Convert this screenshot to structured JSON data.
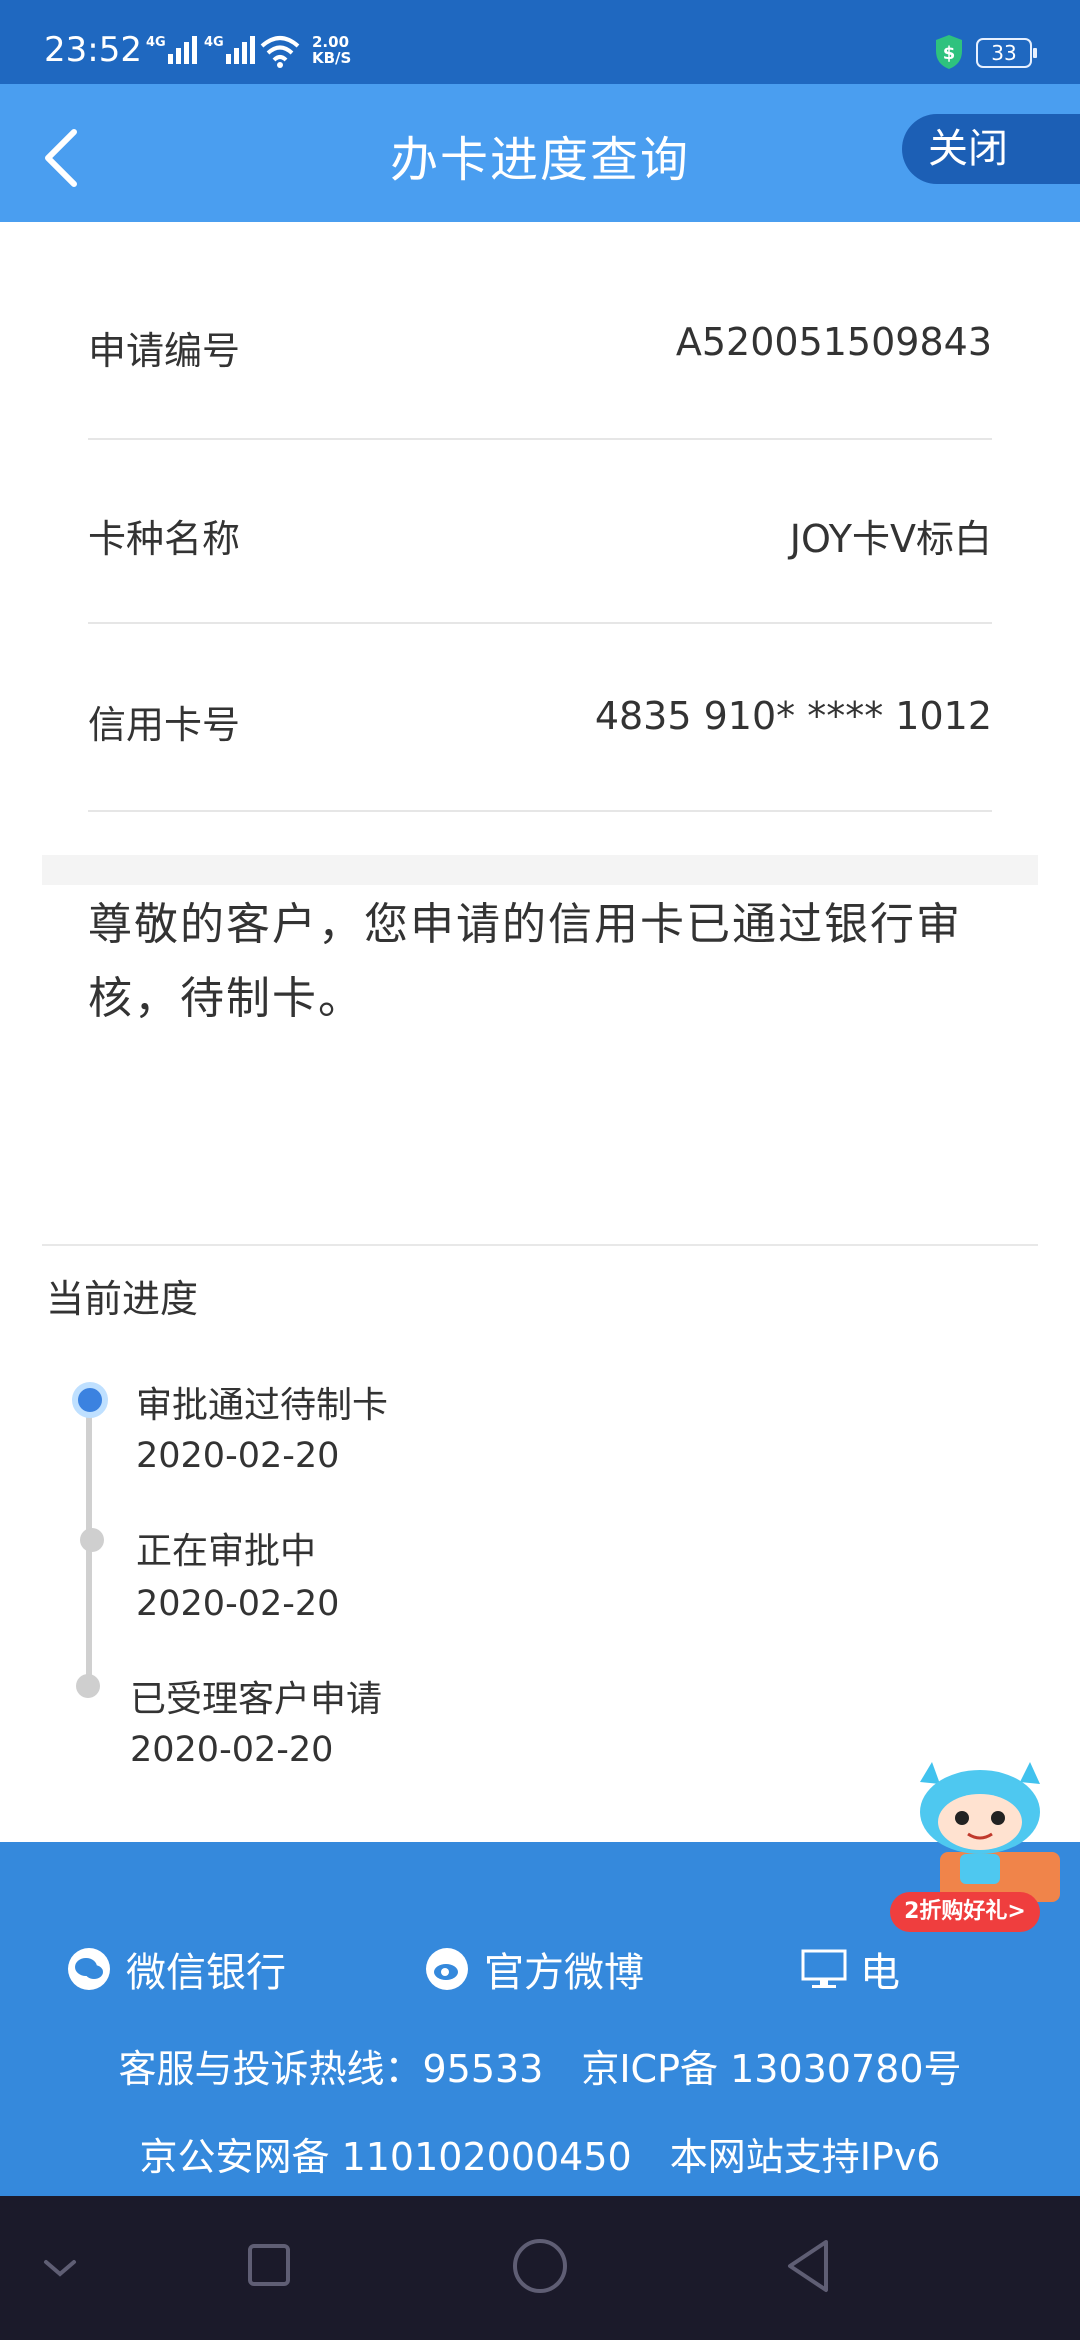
{
  "status_bar": {
    "time": "23:52",
    "signal1": "4G",
    "signal2": "4G",
    "net_speed_value": "2.00",
    "net_speed_unit": "KB/S",
    "battery": "33"
  },
  "header": {
    "title": "办卡进度查询",
    "close_label": "关闭"
  },
  "info": [
    {
      "label": "申请编号",
      "value": "A520051509843"
    },
    {
      "label": "卡种名称",
      "value": "JOY卡V标白"
    },
    {
      "label": "信用卡号",
      "value": "4835 910* **** 1012"
    }
  ],
  "notice": "尊敬的客户，您申请的信用卡已通过银行审核，待制卡。",
  "progress": {
    "title": "当前进度",
    "steps": [
      {
        "name": "审批通过待制卡",
        "date": "2020-02-20",
        "active": true
      },
      {
        "name": "正在审批中",
        "date": "2020-02-20",
        "active": false
      },
      {
        "name": "已受理客户申请",
        "date": "2020-02-20",
        "active": false
      }
    ]
  },
  "footer": {
    "wechat": "微信银行",
    "weibo": "官方微博",
    "pc_partial": "电",
    "hotline": "客服与投诉热线：95533　京ICP备 13030780号",
    "beian": "京公安网备 110102000450　本网站支持IPv6"
  },
  "promo": {
    "badge": "2折购好礼>"
  },
  "colors": {
    "header": "#4a9ef0",
    "status_bar": "#1f68c0",
    "footer": "#3589dc",
    "active_dot": "#3b82e0"
  }
}
